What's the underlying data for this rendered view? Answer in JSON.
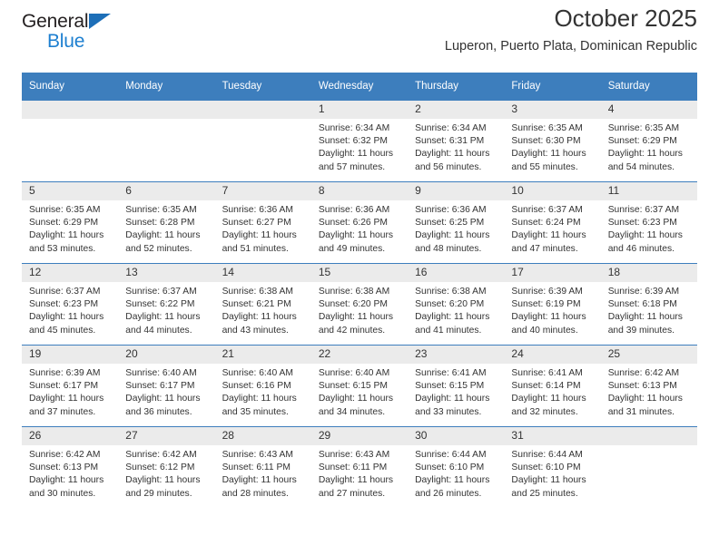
{
  "brand": {
    "line1": "General",
    "line2": "Blue",
    "triangle_icon": "blue-triangle-icon",
    "colors": {
      "general_text": "#231f20",
      "blue_text": "#1d7fd0",
      "triangle": "#1d6fb8"
    }
  },
  "header": {
    "title": "October 2025",
    "subtitle": "Luperon, Puerto Plata, Dominican Republic"
  },
  "theme": {
    "header_bar": "#3d7ebd",
    "day_number_bg": "#ebebeb",
    "text": "#333333"
  },
  "calendar": {
    "weekday_headers": [
      "Sunday",
      "Monday",
      "Tuesday",
      "Wednesday",
      "Thursday",
      "Friday",
      "Saturday"
    ],
    "weeks": [
      [
        {
          "day": "",
          "sunrise": "",
          "sunset": "",
          "daylight": ""
        },
        {
          "day": "",
          "sunrise": "",
          "sunset": "",
          "daylight": ""
        },
        {
          "day": "",
          "sunrise": "",
          "sunset": "",
          "daylight": ""
        },
        {
          "day": "1",
          "sunrise": "Sunrise: 6:34 AM",
          "sunset": "Sunset: 6:32 PM",
          "daylight": "Daylight: 11 hours and 57 minutes."
        },
        {
          "day": "2",
          "sunrise": "Sunrise: 6:34 AM",
          "sunset": "Sunset: 6:31 PM",
          "daylight": "Daylight: 11 hours and 56 minutes."
        },
        {
          "day": "3",
          "sunrise": "Sunrise: 6:35 AM",
          "sunset": "Sunset: 6:30 PM",
          "daylight": "Daylight: 11 hours and 55 minutes."
        },
        {
          "day": "4",
          "sunrise": "Sunrise: 6:35 AM",
          "sunset": "Sunset: 6:29 PM",
          "daylight": "Daylight: 11 hours and 54 minutes."
        }
      ],
      [
        {
          "day": "5",
          "sunrise": "Sunrise: 6:35 AM",
          "sunset": "Sunset: 6:29 PM",
          "daylight": "Daylight: 11 hours and 53 minutes."
        },
        {
          "day": "6",
          "sunrise": "Sunrise: 6:35 AM",
          "sunset": "Sunset: 6:28 PM",
          "daylight": "Daylight: 11 hours and 52 minutes."
        },
        {
          "day": "7",
          "sunrise": "Sunrise: 6:36 AM",
          "sunset": "Sunset: 6:27 PM",
          "daylight": "Daylight: 11 hours and 51 minutes."
        },
        {
          "day": "8",
          "sunrise": "Sunrise: 6:36 AM",
          "sunset": "Sunset: 6:26 PM",
          "daylight": "Daylight: 11 hours and 49 minutes."
        },
        {
          "day": "9",
          "sunrise": "Sunrise: 6:36 AM",
          "sunset": "Sunset: 6:25 PM",
          "daylight": "Daylight: 11 hours and 48 minutes."
        },
        {
          "day": "10",
          "sunrise": "Sunrise: 6:37 AM",
          "sunset": "Sunset: 6:24 PM",
          "daylight": "Daylight: 11 hours and 47 minutes."
        },
        {
          "day": "11",
          "sunrise": "Sunrise: 6:37 AM",
          "sunset": "Sunset: 6:23 PM",
          "daylight": "Daylight: 11 hours and 46 minutes."
        }
      ],
      [
        {
          "day": "12",
          "sunrise": "Sunrise: 6:37 AM",
          "sunset": "Sunset: 6:23 PM",
          "daylight": "Daylight: 11 hours and 45 minutes."
        },
        {
          "day": "13",
          "sunrise": "Sunrise: 6:37 AM",
          "sunset": "Sunset: 6:22 PM",
          "daylight": "Daylight: 11 hours and 44 minutes."
        },
        {
          "day": "14",
          "sunrise": "Sunrise: 6:38 AM",
          "sunset": "Sunset: 6:21 PM",
          "daylight": "Daylight: 11 hours and 43 minutes."
        },
        {
          "day": "15",
          "sunrise": "Sunrise: 6:38 AM",
          "sunset": "Sunset: 6:20 PM",
          "daylight": "Daylight: 11 hours and 42 minutes."
        },
        {
          "day": "16",
          "sunrise": "Sunrise: 6:38 AM",
          "sunset": "Sunset: 6:20 PM",
          "daylight": "Daylight: 11 hours and 41 minutes."
        },
        {
          "day": "17",
          "sunrise": "Sunrise: 6:39 AM",
          "sunset": "Sunset: 6:19 PM",
          "daylight": "Daylight: 11 hours and 40 minutes."
        },
        {
          "day": "18",
          "sunrise": "Sunrise: 6:39 AM",
          "sunset": "Sunset: 6:18 PM",
          "daylight": "Daylight: 11 hours and 39 minutes."
        }
      ],
      [
        {
          "day": "19",
          "sunrise": "Sunrise: 6:39 AM",
          "sunset": "Sunset: 6:17 PM",
          "daylight": "Daylight: 11 hours and 37 minutes."
        },
        {
          "day": "20",
          "sunrise": "Sunrise: 6:40 AM",
          "sunset": "Sunset: 6:17 PM",
          "daylight": "Daylight: 11 hours and 36 minutes."
        },
        {
          "day": "21",
          "sunrise": "Sunrise: 6:40 AM",
          "sunset": "Sunset: 6:16 PM",
          "daylight": "Daylight: 11 hours and 35 minutes."
        },
        {
          "day": "22",
          "sunrise": "Sunrise: 6:40 AM",
          "sunset": "Sunset: 6:15 PM",
          "daylight": "Daylight: 11 hours and 34 minutes."
        },
        {
          "day": "23",
          "sunrise": "Sunrise: 6:41 AM",
          "sunset": "Sunset: 6:15 PM",
          "daylight": "Daylight: 11 hours and 33 minutes."
        },
        {
          "day": "24",
          "sunrise": "Sunrise: 6:41 AM",
          "sunset": "Sunset: 6:14 PM",
          "daylight": "Daylight: 11 hours and 32 minutes."
        },
        {
          "day": "25",
          "sunrise": "Sunrise: 6:42 AM",
          "sunset": "Sunset: 6:13 PM",
          "daylight": "Daylight: 11 hours and 31 minutes."
        }
      ],
      [
        {
          "day": "26",
          "sunrise": "Sunrise: 6:42 AM",
          "sunset": "Sunset: 6:13 PM",
          "daylight": "Daylight: 11 hours and 30 minutes."
        },
        {
          "day": "27",
          "sunrise": "Sunrise: 6:42 AM",
          "sunset": "Sunset: 6:12 PM",
          "daylight": "Daylight: 11 hours and 29 minutes."
        },
        {
          "day": "28",
          "sunrise": "Sunrise: 6:43 AM",
          "sunset": "Sunset: 6:11 PM",
          "daylight": "Daylight: 11 hours and 28 minutes."
        },
        {
          "day": "29",
          "sunrise": "Sunrise: 6:43 AM",
          "sunset": "Sunset: 6:11 PM",
          "daylight": "Daylight: 11 hours and 27 minutes."
        },
        {
          "day": "30",
          "sunrise": "Sunrise: 6:44 AM",
          "sunset": "Sunset: 6:10 PM",
          "daylight": "Daylight: 11 hours and 26 minutes."
        },
        {
          "day": "31",
          "sunrise": "Sunrise: 6:44 AM",
          "sunset": "Sunset: 6:10 PM",
          "daylight": "Daylight: 11 hours and 25 minutes."
        },
        {
          "day": "",
          "sunrise": "",
          "sunset": "",
          "daylight": ""
        }
      ]
    ]
  }
}
